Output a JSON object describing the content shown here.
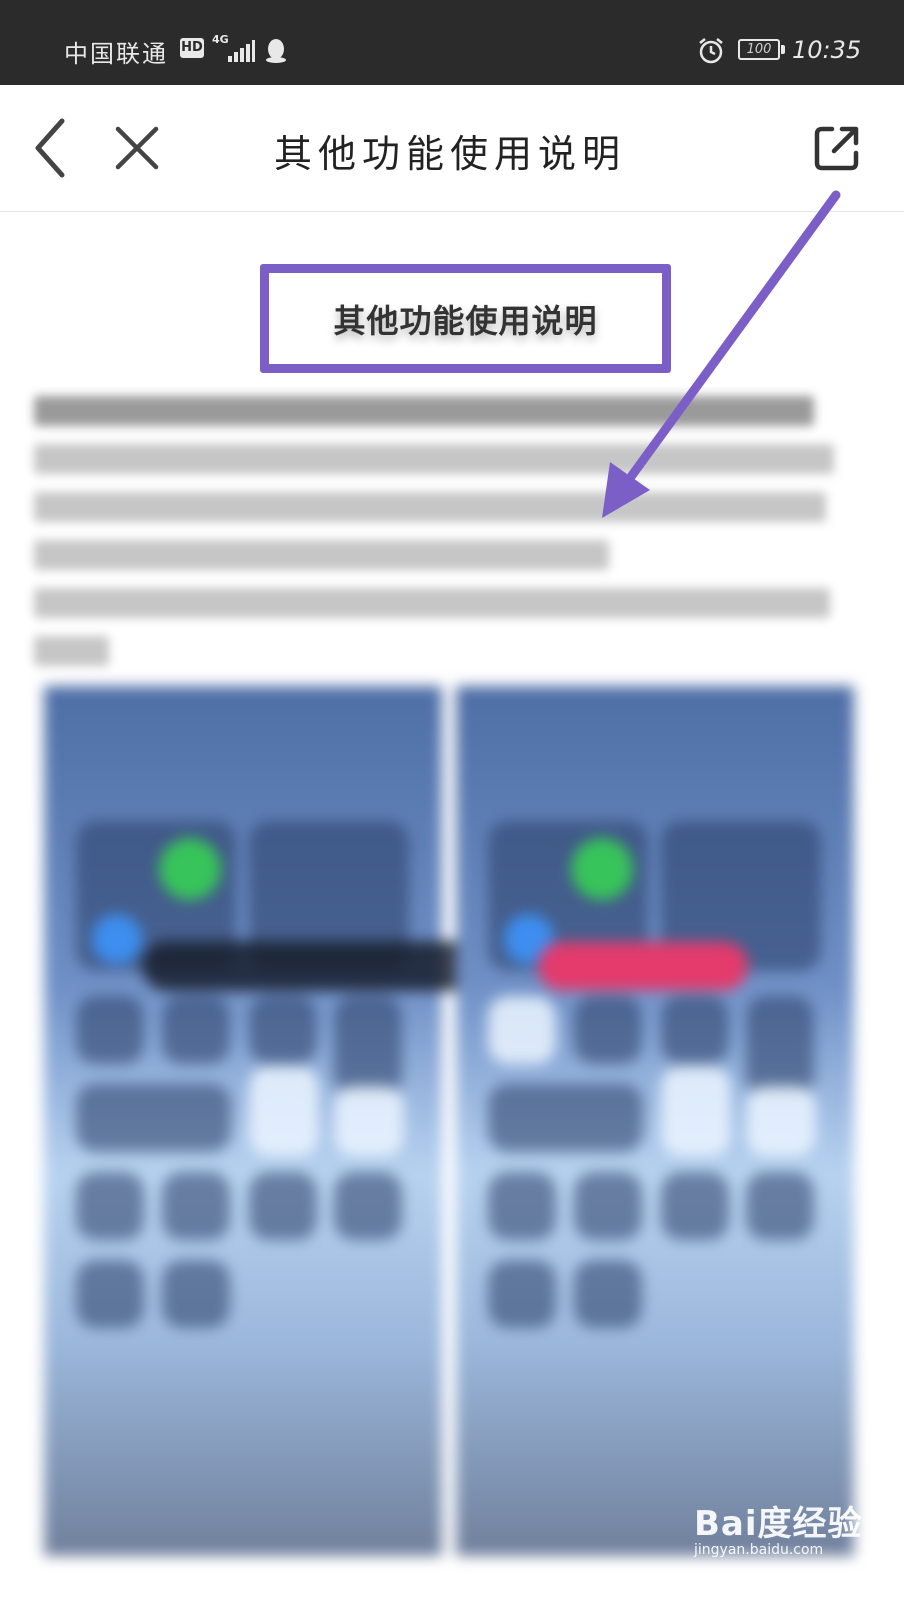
{
  "status_bar": {
    "carrier": "中国联通",
    "hd_badge": "HD",
    "network_type": "4G",
    "battery_level": "100",
    "time": "10:35",
    "text_color": "#e8e8e8",
    "background": "#2b2b2b"
  },
  "nav": {
    "title": "其他功能使用说明",
    "back_icon": "chevron-left-icon",
    "close_icon": "close-icon",
    "share_icon": "external-share-icon"
  },
  "article": {
    "title": "其他功能使用说明",
    "highlight_color": "#7b5fc6",
    "blurred": true
  },
  "annotation": {
    "arrow_color": "#7b5fc6",
    "arrow_icon": "pointer-arrow-icon"
  },
  "watermark": {
    "logo_text": "Bai度经验",
    "url": "jingyan.baidu.com"
  }
}
